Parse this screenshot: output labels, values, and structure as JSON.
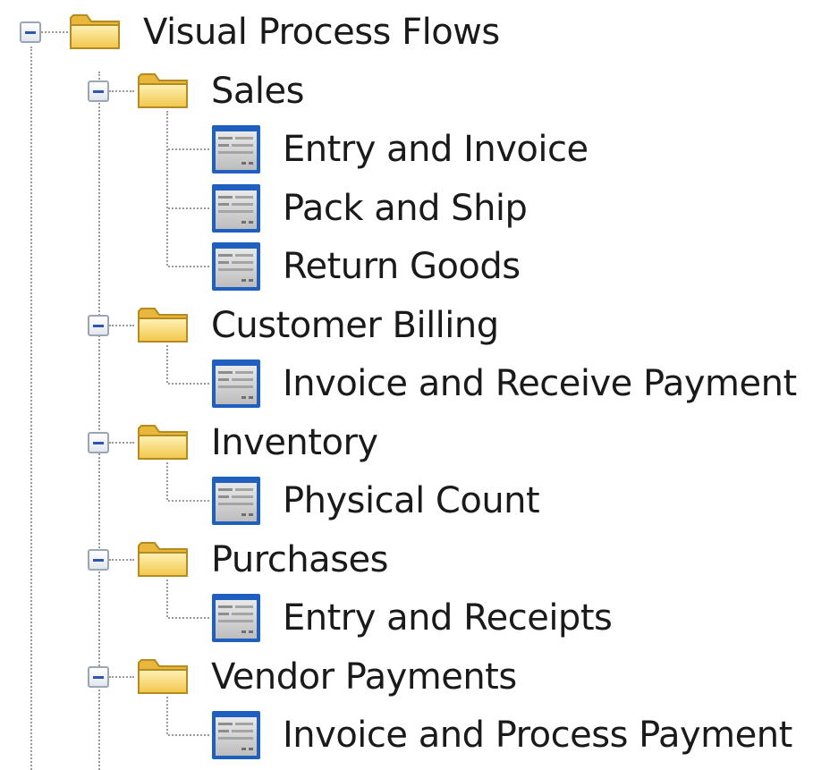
{
  "tree": {
    "root": {
      "label": "Visual Process Flows",
      "expander": "minus",
      "icon": "folder-icon"
    },
    "groups": [
      {
        "label": "Sales",
        "icon": "folder-icon",
        "expander": "minus",
        "items": [
          {
            "label": "Entry and Invoice",
            "icon": "form-icon"
          },
          {
            "label": "Pack and Ship",
            "icon": "form-icon"
          },
          {
            "label": "Return Goods",
            "icon": "form-icon"
          }
        ]
      },
      {
        "label": "Customer Billing",
        "icon": "folder-icon",
        "expander": "minus",
        "items": [
          {
            "label": "Invoice and Receive Payment",
            "icon": "form-icon"
          }
        ]
      },
      {
        "label": "Inventory",
        "icon": "folder-icon",
        "expander": "minus",
        "items": [
          {
            "label": "Physical Count",
            "icon": "form-icon"
          }
        ]
      },
      {
        "label": "Purchases",
        "icon": "folder-icon",
        "expander": "minus",
        "items": [
          {
            "label": "Entry and Receipts",
            "icon": "form-icon"
          }
        ]
      },
      {
        "label": "Vendor Payments",
        "icon": "folder-icon",
        "expander": "minus",
        "items": [
          {
            "label": "Invoice and Process Payment",
            "icon": "form-icon"
          }
        ]
      }
    ]
  }
}
